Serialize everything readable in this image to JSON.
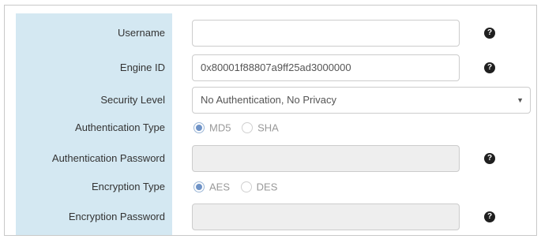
{
  "form": {
    "username": {
      "label": "Username",
      "value": ""
    },
    "engine_id": {
      "label": "Engine ID",
      "value": "0x80001f88807a9ff25ad3000000"
    },
    "security_level": {
      "label": "Security Level",
      "selected": "No Authentication, No Privacy"
    },
    "authentication_type": {
      "label": "Authentication Type",
      "options": [
        "MD5",
        "SHA"
      ],
      "selected": "MD5"
    },
    "authentication_password": {
      "label": "Authentication Password",
      "value": ""
    },
    "encryption_type": {
      "label": "Encryption Type",
      "options": [
        "AES",
        "DES"
      ],
      "selected": "AES"
    },
    "encryption_password": {
      "label": "Encryption Password",
      "value": ""
    }
  },
  "icons": {
    "help": "question-circle-icon",
    "dropdown": "caret-down-icon"
  },
  "colors": {
    "label_column_bg": "#d4e8f2",
    "radio_selected": "#6f93c7",
    "disabled_input_bg": "#eeeeee"
  }
}
